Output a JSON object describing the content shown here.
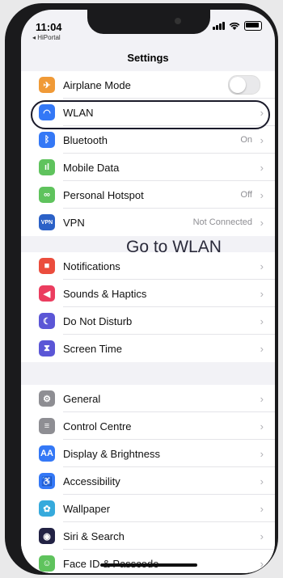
{
  "status_bar": {
    "time": "11:04",
    "carrier": "◂ HiPortal"
  },
  "nav": {
    "title": "Settings"
  },
  "annotation": "Go to WLAN",
  "groups": [
    {
      "items": [
        {
          "label": "Airplane Mode",
          "icon": "airplane-icon",
          "color": "#f09a37",
          "value": "",
          "control": "toggle-off"
        },
        {
          "label": "WLAN",
          "icon": "wifi-icon",
          "color": "#3478f6",
          "value": "",
          "control": "chevron"
        },
        {
          "label": "Bluetooth",
          "icon": "bluetooth-icon",
          "color": "#3478f6",
          "value": "On",
          "control": "chevron"
        },
        {
          "label": "Mobile Data",
          "icon": "antenna-icon",
          "color": "#5fc35d",
          "value": "",
          "control": "chevron"
        },
        {
          "label": "Personal Hotspot",
          "icon": "hotspot-icon",
          "color": "#5fc35d",
          "value": "Off",
          "control": "chevron"
        },
        {
          "label": "VPN",
          "icon": "vpn-icon",
          "color": "#2b61c7",
          "value": "Not Connected",
          "control": "chevron"
        }
      ]
    },
    {
      "items": [
        {
          "label": "Notifications",
          "icon": "notifications-icon",
          "color": "#eb4d3d",
          "value": "",
          "control": "chevron"
        },
        {
          "label": "Sounds & Haptics",
          "icon": "speaker-icon",
          "color": "#eb3d5f",
          "value": "",
          "control": "chevron"
        },
        {
          "label": "Do Not Disturb",
          "icon": "moon-icon",
          "color": "#5b56d6",
          "value": "",
          "control": "chevron"
        },
        {
          "label": "Screen Time",
          "icon": "hourglass-icon",
          "color": "#5b56d6",
          "value": "",
          "control": "chevron"
        }
      ]
    },
    {
      "items": [
        {
          "label": "General",
          "icon": "gear-icon",
          "color": "#8e8e93",
          "value": "",
          "control": "chevron"
        },
        {
          "label": "Control Centre",
          "icon": "switches-icon",
          "color": "#8e8e93",
          "value": "",
          "control": "chevron"
        },
        {
          "label": "Display & Brightness",
          "icon": "display-icon",
          "color": "#3478f6",
          "value": "",
          "control": "chevron"
        },
        {
          "label": "Accessibility",
          "icon": "accessibility-icon",
          "color": "#3478f6",
          "value": "",
          "control": "chevron"
        },
        {
          "label": "Wallpaper",
          "icon": "wallpaper-icon",
          "color": "#36aadc",
          "value": "",
          "control": "chevron"
        },
        {
          "label": "Siri & Search",
          "icon": "siri-icon",
          "color": "#222244",
          "value": "",
          "control": "chevron"
        },
        {
          "label": "Face ID & Passcode",
          "icon": "faceid-icon",
          "color": "#5fc35d",
          "value": "",
          "control": "chevron"
        }
      ]
    }
  ]
}
